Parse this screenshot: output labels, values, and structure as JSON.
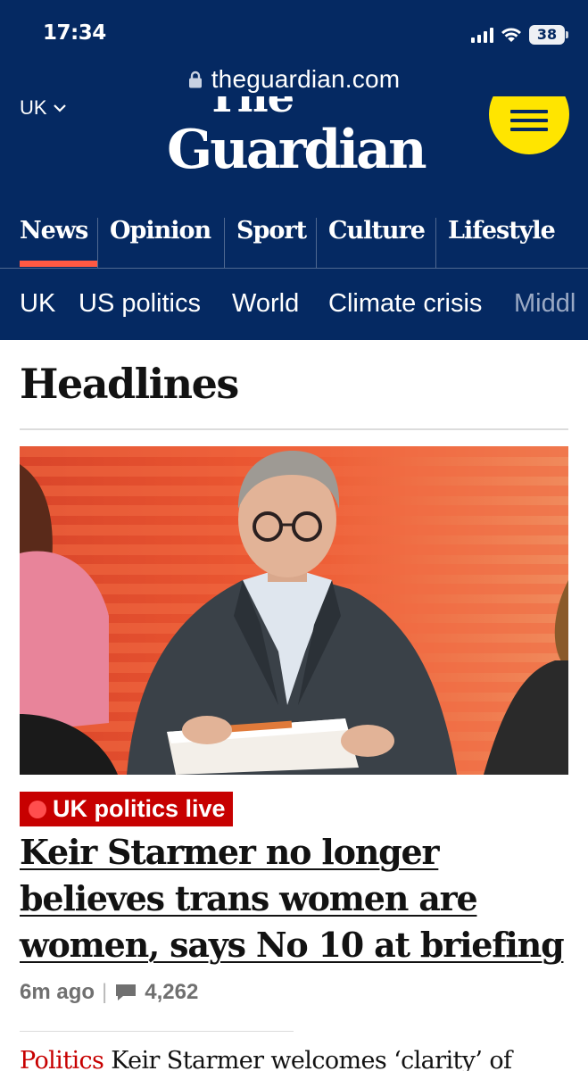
{
  "status_bar": {
    "time": "17:34",
    "battery": "38",
    "icons": [
      "signal-icon",
      "wifi-icon",
      "battery-icon"
    ]
  },
  "browser": {
    "url": "theguardian.com",
    "icons": [
      "lock-icon"
    ]
  },
  "masthead": {
    "edition": "UK",
    "logo_the": "The",
    "logo_guardian": "Guardian",
    "menu_icon": "hamburger-menu-icon",
    "colors": {
      "background": "#052962",
      "menu_button": "#ffe500"
    }
  },
  "pillars": [
    {
      "label": "News",
      "selected": true
    },
    {
      "label": "Opinion",
      "selected": false
    },
    {
      "label": "Sport",
      "selected": false
    },
    {
      "label": "Culture",
      "selected": false
    },
    {
      "label": "Lifestyle",
      "selected": false
    }
  ],
  "subnav": [
    "UK",
    "US politics",
    "World",
    "Climate crisis",
    "Middl"
  ],
  "section": {
    "title": "Headlines"
  },
  "lead_story": {
    "kicker": "UK politics live",
    "headline": "Keir Starmer no longer believes trans women are women, says No 10 at briefing",
    "age": "6m ago",
    "separator": "|",
    "comment_count": "4,262",
    "kicker_color": "#c70000"
  },
  "next_story": {
    "kicker": "Politics",
    "headline": "Keir Starmer welcomes ‘clarity’ of"
  }
}
